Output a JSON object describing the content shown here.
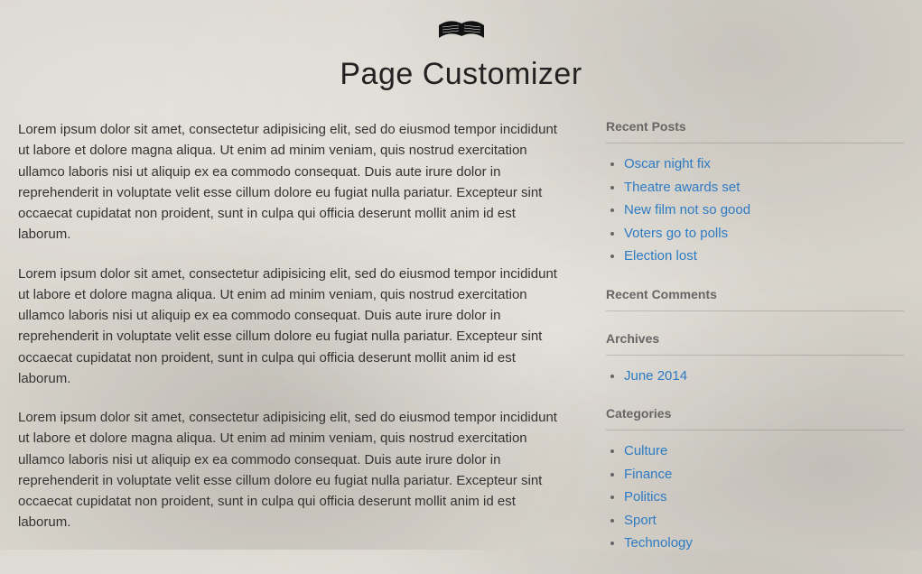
{
  "header": {
    "icon": "book-icon",
    "title": "Page Customizer"
  },
  "main": {
    "paragraphs": [
      "Lorem ipsum dolor sit amet, consectetur adipisicing elit, sed do eiusmod tempor incididunt ut labore et dolore magna aliqua. Ut enim ad minim veniam, quis nostrud exercitation ullamco laboris nisi ut aliquip ex ea commodo consequat. Duis aute irure dolor in reprehenderit in voluptate velit esse cillum dolore eu fugiat nulla pariatur. Excepteur sint occaecat cupidatat non proident, sunt in culpa qui officia deserunt mollit anim id est laborum.",
      "Lorem ipsum dolor sit amet, consectetur adipisicing elit, sed do eiusmod tempor incididunt ut labore et dolore magna aliqua. Ut enim ad minim veniam, quis nostrud exercitation ullamco laboris nisi ut aliquip ex ea commodo consequat. Duis aute irure dolor in reprehenderit in voluptate velit esse cillum dolore eu fugiat nulla pariatur. Excepteur sint occaecat cupidatat non proident, sunt in culpa qui officia deserunt mollit anim id est laborum.",
      "Lorem ipsum dolor sit amet, consectetur adipisicing elit, sed do eiusmod tempor incididunt ut labore et dolore magna aliqua. Ut enim ad minim veniam, quis nostrud exercitation ullamco laboris nisi ut aliquip ex ea commodo consequat. Duis aute irure dolor in reprehenderit in voluptate velit esse cillum dolore eu fugiat nulla pariatur. Excepteur sint occaecat cupidatat non proident, sunt in culpa qui officia deserunt mollit anim id est laborum."
    ]
  },
  "sidebar": {
    "recent_posts": {
      "title": "Recent Posts",
      "items": [
        "Oscar night fix",
        "Theatre awards set",
        "New film not so good",
        "Voters go to polls",
        "Election lost"
      ]
    },
    "recent_comments": {
      "title": "Recent Comments"
    },
    "archives": {
      "title": "Archives",
      "items": [
        "June 2014"
      ]
    },
    "categories": {
      "title": "Categories",
      "items": [
        "Culture",
        "Finance",
        "Politics",
        "Sport",
        "Technology"
      ]
    }
  },
  "colors": {
    "link": "#2e7bc4",
    "heading": "#666"
  }
}
